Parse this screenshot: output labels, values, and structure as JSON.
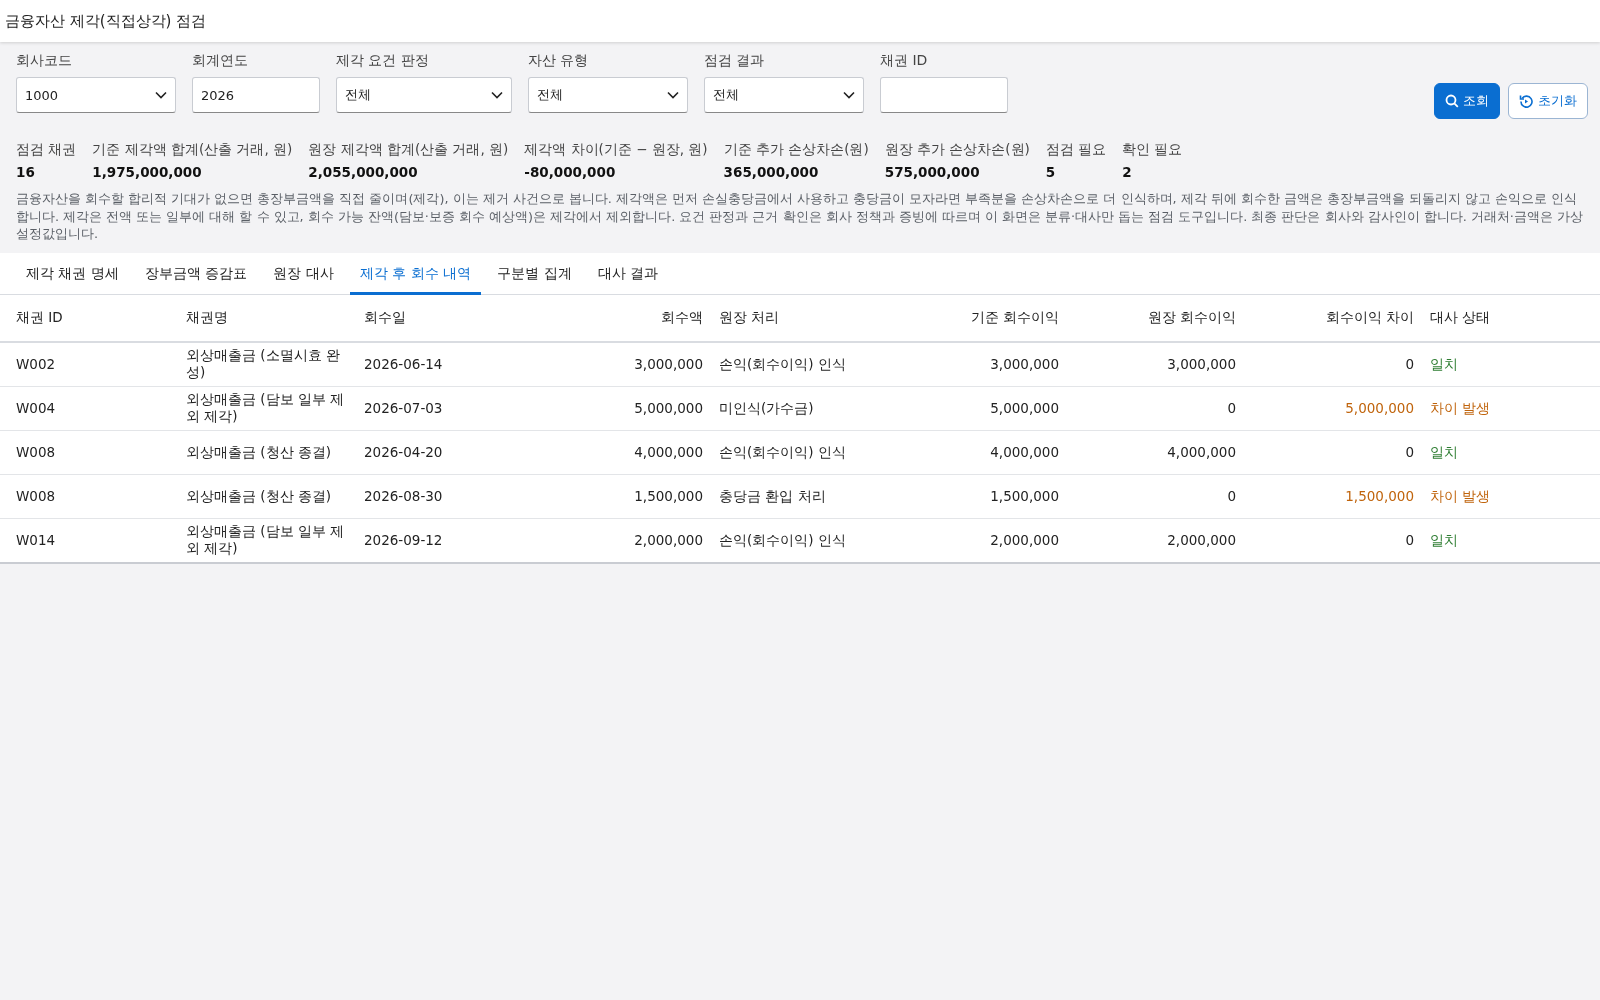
{
  "window": {
    "title": "금융자산 제각(직접상각) 점검"
  },
  "filters": [
    {
      "label": "회사코드",
      "kind": "select",
      "value": "1000"
    },
    {
      "label": "회계연도",
      "kind": "text",
      "value": "2026"
    },
    {
      "label": "제각 요건 판정",
      "kind": "select",
      "value": "전체"
    },
    {
      "label": "자산 유형",
      "kind": "select",
      "value": "전체"
    },
    {
      "label": "점검 결과",
      "kind": "select",
      "value": "전체"
    },
    {
      "label": "채권 ID",
      "kind": "text"
    }
  ],
  "buttons": [
    {
      "label": "조회",
      "kind": "primary"
    },
    {
      "label": "초기화",
      "kind": "secondary"
    }
  ],
  "summary": [
    {
      "label": "점검 채권",
      "value": "16"
    },
    {
      "label": "기준 제각액 합계(산출 거래, 원)",
      "value": "1,975,000,000"
    },
    {
      "label": "원장 제각액 합계(산출 거래, 원)",
      "value": "2,055,000,000"
    },
    {
      "label": "제각액 차이(기준 − 원장, 원)",
      "value": "-80,000,000"
    },
    {
      "label": "기준 추가 손상차손(원)",
      "value": "365,000,000"
    },
    {
      "label": "원장 추가 손상차손(원)",
      "value": "575,000,000"
    },
    {
      "label": "점검 필요",
      "value": "5"
    },
    {
      "label": "확인 필요",
      "value": "2"
    }
  ],
  "description": "금융자산을 회수할 합리적 기대가 없으면 총장부금액을 직접 줄이며(제각), 이는 제거 사건으로 봅니다. 제각액은 먼저 손실충당금에서 사용하고 충당금이 모자라면 부족분을 손상차손으로 더 인식하며, 제각 뒤에 회수한 금액은 총장부금액을 되돌리지 않고 손익으로 인식합니다. 제각은 전액 또는 일부에 대해 할 수 있고, 회수 가능 잔액(담보·보증 회수 예상액)은 제각에서 제외합니다. 요건 판정과 근거 확인은 회사 정책과 증빙에 따르며 이 화면은 분류·대사만 돕는 점검 도구입니다. 최종 판단은 회사와 감사인이 합니다. 거래처·금액은 가상 설정값입니다.",
  "tabs": [
    {
      "label": "제각 채권 명세",
      "selected": false
    },
    {
      "label": "장부금액 증감표",
      "selected": false
    },
    {
      "label": "원장 대사",
      "selected": false
    },
    {
      "label": "제각 후 회수 내역",
      "selected": true
    },
    {
      "label": "구분별 집계",
      "selected": false
    },
    {
      "label": "대사 결과",
      "selected": false
    }
  ],
  "table": {
    "columns": [
      "채권 ID",
      "채권명",
      "회수일",
      "회수액",
      "원장 처리",
      "기준 회수이익",
      "원장 회수이익",
      "회수이익 차이",
      "대사 상태"
    ],
    "rows": [
      {
        "cells": [
          "W002",
          "외상매출금 (소멸시효 완성)",
          "2026-06-14",
          "3,000,000",
          "손익(회수이익) 인식",
          "3,000,000",
          "3,000,000",
          "0",
          "일치"
        ],
        "matched": true
      },
      {
        "cells": [
          "W004",
          "외상매출금 (담보 일부 제외 제각)",
          "2026-07-03",
          "5,000,000",
          "미인식(가수금)",
          "5,000,000",
          "0",
          "5,000,000",
          "차이 발생"
        ],
        "matched": false
      },
      {
        "cells": [
          "W008",
          "외상매출금 (청산 종결)",
          "2026-04-20",
          "4,000,000",
          "손익(회수이익) 인식",
          "4,000,000",
          "4,000,000",
          "0",
          "일치"
        ],
        "matched": true
      },
      {
        "cells": [
          "W008",
          "외상매출금 (청산 종결)",
          "2026-08-30",
          "1,500,000",
          "충당금 환입 처리",
          "1,500,000",
          "0",
          "1,500,000",
          "차이 발생"
        ],
        "matched": false
      },
      {
        "cells": [
          "W014",
          "외상매출금 (담보 일부 제외 제각)",
          "2026-09-12",
          "2,000,000",
          "손익(회수이익) 인식",
          "2,000,000",
          "2,000,000",
          "0",
          "일치"
        ],
        "matched": true
      }
    ]
  }
}
